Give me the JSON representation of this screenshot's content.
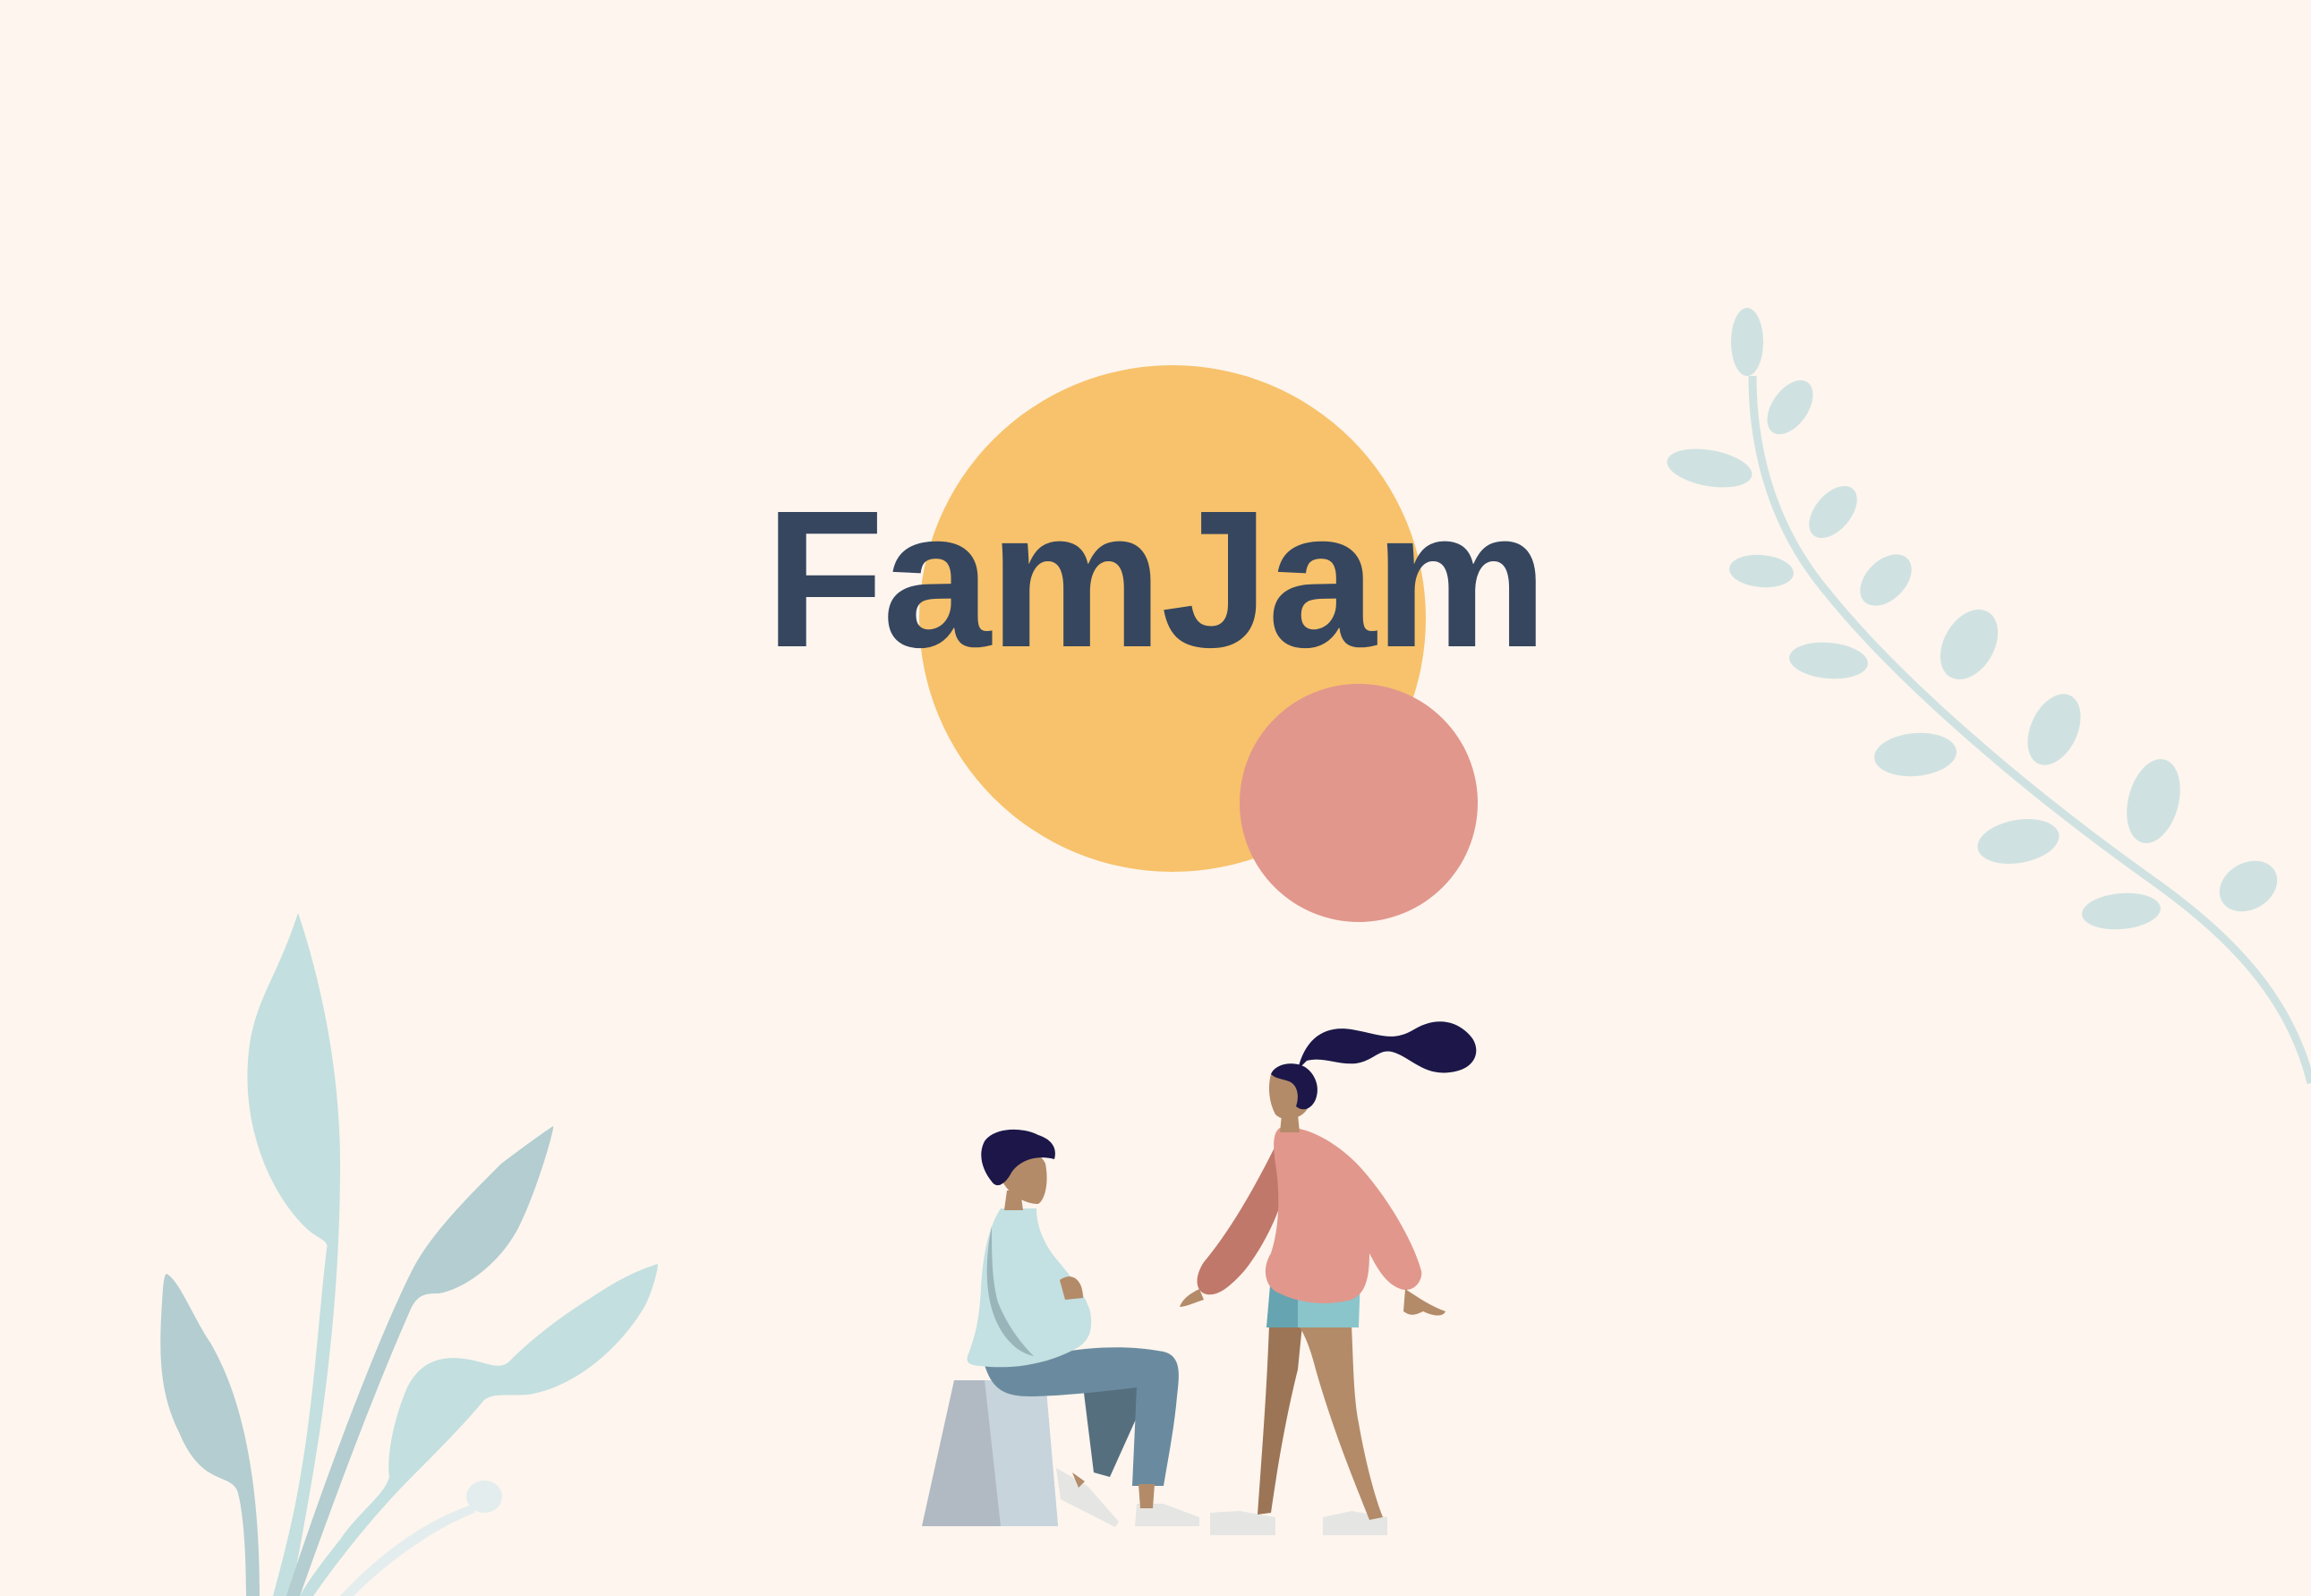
{
  "app": {
    "title": "FamJam"
  },
  "colors": {
    "background": "#fdf5ee",
    "title": "#36465f",
    "sun": "#f7c26b",
    "small_circle": "#e1978c",
    "foliage": "#cfe2e1",
    "person_sitting_top": "#c3e0e2",
    "person_standing_top": "#e1978c",
    "hair": "#1c1748"
  },
  "icons": [
    "sun-circle",
    "pink-circle",
    "left-plant-illustration",
    "right-branch-illustration",
    "sitting-person-illustration",
    "standing-person-illustration"
  ]
}
